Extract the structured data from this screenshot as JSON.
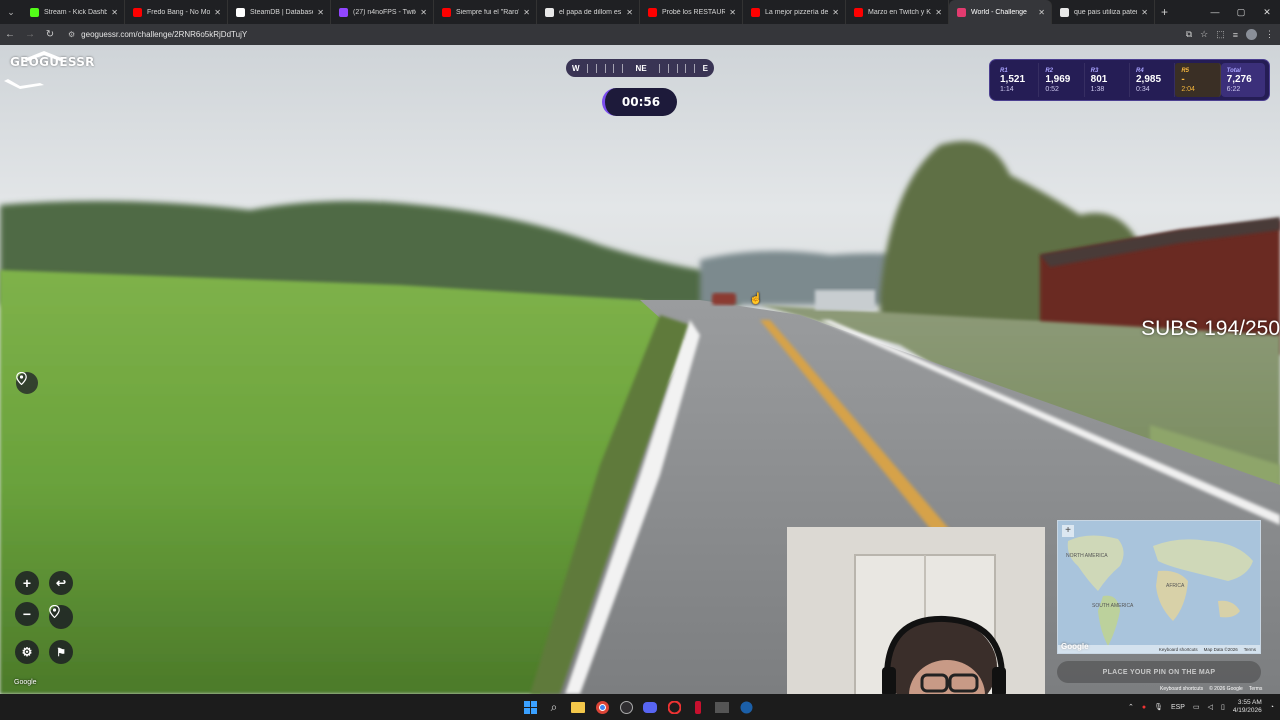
{
  "browser": {
    "tabs": [
      {
        "title": "Stream - Kick Dashbo...",
        "color": "#53fc18",
        "active": false
      },
      {
        "title": "Fredo Bang - No Mo...",
        "color": "#ff0000",
        "active": false
      },
      {
        "title": "SteamDB | Database ...",
        "color": "#ffffff",
        "active": false
      },
      {
        "title": "(27) n4noFPS - Twitch",
        "color": "#9146ff",
        "active": false
      },
      {
        "title": "Siempre fui el \"Raro\"...",
        "color": "#ff0000",
        "active": false
      },
      {
        "title": "el papa de dillom es j...",
        "color": "#e8e8e8",
        "active": false
      },
      {
        "title": "Probé los RESTAURAN...",
        "color": "#ff0000",
        "active": false
      },
      {
        "title": "La mejor pizzería de ...",
        "color": "#ff0000",
        "active": false
      },
      {
        "title": "Marzo en Twitch y Kic...",
        "color": "#ff0000",
        "active": false
      },
      {
        "title": "World - Challenge",
        "color": "#e23b6f",
        "active": true
      },
      {
        "title": "que pais utiliza paten...",
        "color": "#e8e8e8",
        "active": false
      }
    ],
    "url": "geoguessr.com/challenge/2RNR6o5kRjDdTujY"
  },
  "game": {
    "logo": "GEOGUESSR",
    "compass_left": "W",
    "compass_dir": "NE",
    "compass_right": "E",
    "timer": "00:56",
    "rounds": [
      {
        "label": "R1",
        "score": "1,521",
        "time": "1:14"
      },
      {
        "label": "R2",
        "score": "1,969",
        "time": "0:52"
      },
      {
        "label": "R3",
        "score": "801",
        "time": "1:38"
      },
      {
        "label": "R4",
        "score": "2,985",
        "time": "0:34"
      },
      {
        "label": "R5",
        "score": "-",
        "time": "2:04"
      }
    ],
    "total": {
      "label": "Total",
      "score": "7,276",
      "time": "6:22"
    },
    "place_pin": "PLACE YOUR PIN ON THE MAP",
    "google_watermark": "Google"
  },
  "overlay": {
    "subs": "SUBS 194/250"
  },
  "minimap": {
    "labels": [
      "NORTH AMERICA",
      "AFRICA",
      "SOUTH AMERICA"
    ],
    "footer": [
      "Keyboard shortcuts",
      "Map Data ©2026",
      "Terms"
    ],
    "google": "Google",
    "legal": [
      "Keyboard shortcuts",
      "© 2026 Google",
      "Terms"
    ]
  },
  "taskbar": {
    "lang": "ESP",
    "time": "3:55 AM",
    "date": "4/19/2026"
  }
}
